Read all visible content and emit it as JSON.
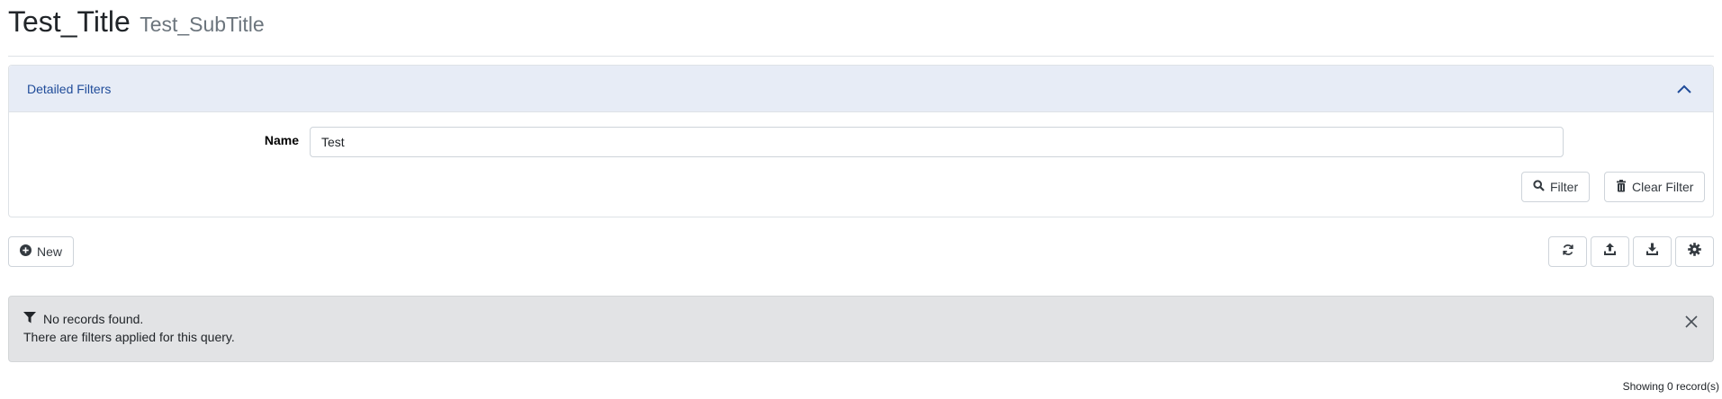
{
  "header": {
    "title": "Test_Title",
    "subtitle": "Test_SubTitle"
  },
  "filters": {
    "title": "Detailed Filters",
    "name_label": "Name",
    "name_value": "Test",
    "filter_button": "Filter",
    "clear_button": "Clear Filter",
    "collapse_icon": "chevron-up-icon"
  },
  "toolbar": {
    "new_button": "New",
    "icons": [
      "refresh-icon",
      "upload-icon",
      "download-icon",
      "gear-icon"
    ]
  },
  "alert": {
    "line1": "No records found.",
    "line2": "There are filters applied for this query.",
    "icon": "funnel-icon",
    "close_icon": "close-icon"
  },
  "footer": {
    "record_count": "Showing 0 record(s)"
  },
  "colors": {
    "accent_header_bg": "#e7ecf6",
    "accent_header_text": "#1f4b99",
    "alert_bg": "#e2e3e5"
  }
}
